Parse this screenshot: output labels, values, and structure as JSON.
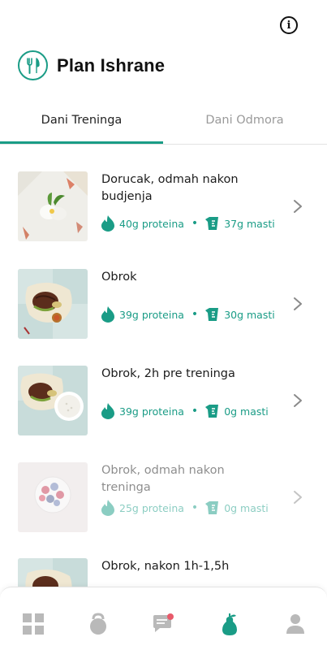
{
  "header": {
    "title": "Plan Ishrane",
    "info_glyph": "i"
  },
  "tabs": [
    {
      "label": "Dani Treninga",
      "active": true
    },
    {
      "label": "Dani Odmora",
      "active": false
    }
  ],
  "meals": [
    {
      "name": "Dorucak, odmah nakon budjenja",
      "protein": "40g proteina",
      "fat": "37g masti",
      "dimmed": false
    },
    {
      "name": "Obrok",
      "protein": "39g proteina",
      "fat": "30g masti",
      "dimmed": false
    },
    {
      "name": "Obrok, 2h pre treninga",
      "protein": "39g proteina",
      "fat": "0g masti",
      "dimmed": false
    },
    {
      "name": "Obrok, odmah nakon treninga",
      "protein": "25g proteina",
      "fat": "0g masti",
      "dimmed": true
    },
    {
      "name": "Obrok, nakon 1h-1,5h",
      "protein": "",
      "fat": "",
      "dimmed": false
    }
  ],
  "separator": "•",
  "bottom_nav": {
    "items": [
      "grid-icon",
      "kettlebell-icon",
      "chat-icon",
      "pear-icon",
      "profile-icon"
    ],
    "active": "pear-icon",
    "chat_has_notification": true
  },
  "colors": {
    "accent": "#1a9c86",
    "inactive": "#9a9a9a",
    "notification": "#e85a6a",
    "nav_icon": "#b9b9b9"
  }
}
